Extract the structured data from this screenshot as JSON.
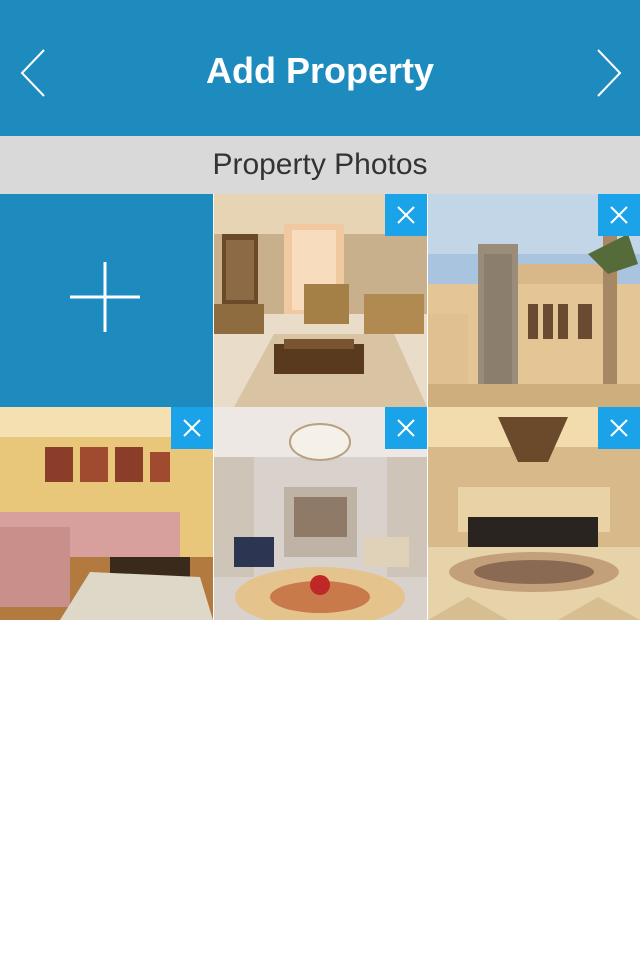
{
  "header": {
    "title": "Add Property",
    "back_icon": "chevron-left-icon",
    "next_icon": "chevron-right-icon"
  },
  "section": {
    "label": "Property Photos"
  },
  "photos": {
    "add_icon": "plus-icon",
    "remove_icon": "close-icon",
    "items": [
      {
        "subject": "living-room-beige"
      },
      {
        "subject": "house-exterior"
      },
      {
        "subject": "pink-sofa-room"
      },
      {
        "subject": "chandelier-hall"
      },
      {
        "subject": "marble-lobby"
      }
    ]
  },
  "colors": {
    "header": "#1e8bbf",
    "section_bar": "#d9d9d9",
    "remove_button": "#1aa3e8"
  }
}
